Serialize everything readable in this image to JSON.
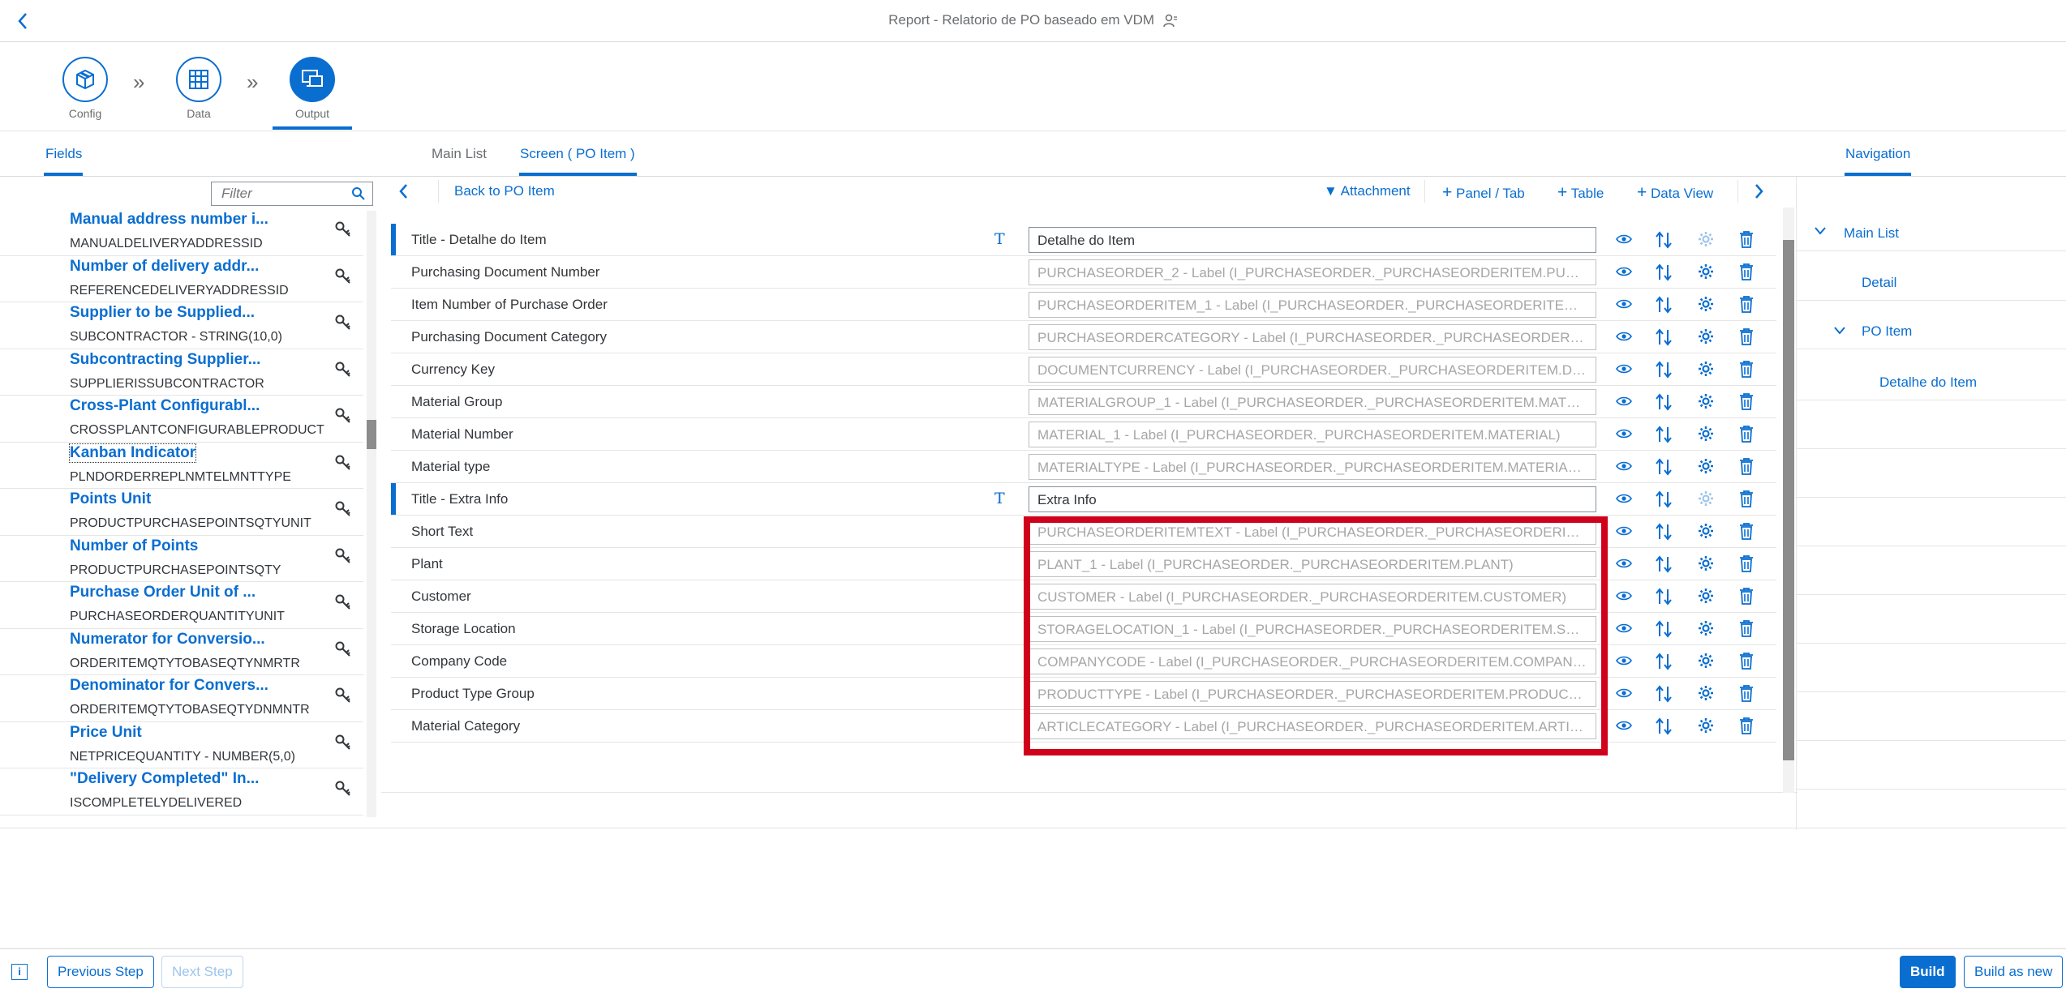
{
  "shell": {
    "title": "Report - Relatorio de PO baseado em VDM"
  },
  "wizard": {
    "steps": [
      {
        "label": "Config",
        "icon": "cube-icon"
      },
      {
        "label": "Data",
        "icon": "table-icon"
      },
      {
        "label": "Output",
        "icon": "output-icon",
        "active": true
      }
    ]
  },
  "tabs": {
    "fields": "Fields",
    "main_list": "Main List",
    "screen": "Screen ( PO Item )",
    "navigation": "Navigation"
  },
  "filter": {
    "placeholder": "Filter"
  },
  "fields": [
    {
      "name": "Manual address number i...",
      "id": "MANUALDELIVERYADDRESSID"
    },
    {
      "name": "Number of delivery addr...",
      "id": "REFERENCEDELIVERYADDRESSID"
    },
    {
      "name": "Supplier to be Supplied...",
      "id": "SUBCONTRACTOR - STRING(10,0)"
    },
    {
      "name": "Subcontracting Supplier...",
      "id": "SUPPLIERISSUBCONTRACTOR"
    },
    {
      "name": "Cross-Plant Configurabl...",
      "id": "CROSSPLANTCONFIGURABLEPRODUCT"
    },
    {
      "name": "Kanban Indicator",
      "id": "PLNDORDERREPLNMTELMNTTYPE"
    },
    {
      "name": "Points Unit",
      "id": "PRODUCTPURCHASEPOINTSQTYUNIT"
    },
    {
      "name": "Number of Points",
      "id": "PRODUCTPURCHASEPOINTSQTY"
    },
    {
      "name": "Purchase Order Unit of ...",
      "id": "PURCHASEORDERQUANTITYUNIT"
    },
    {
      "name": "Numerator for Conversio...",
      "id": "ORDERITEMQTYTOBASEQTYNMRTR"
    },
    {
      "name": "Denominator for Convers...",
      "id": "ORDERITEMQTYTOBASEQTYDNMNTR"
    },
    {
      "name": "Price Unit",
      "id": "NETPRICEQUANTITY - NUMBER(5,0)"
    },
    {
      "name": "\"Delivery Completed\" In...",
      "id": "ISCOMPLETELYDELIVERED"
    }
  ],
  "toolbar": {
    "back": "Back to PO Item",
    "attachment": "Attachment",
    "panel_tab": "Panel / Tab",
    "table": "Table",
    "data_view": "Data View"
  },
  "rows": [
    {
      "label": "Title - Detalhe do Item",
      "value": "Detalhe do Item",
      "title": true
    },
    {
      "label": "Purchasing Document Number",
      "value": "PURCHASEORDER_2 - Label (I_PURCHASEORDER._PURCHASEORDERITEM.PURC..."
    },
    {
      "label": "Item Number of Purchase Order",
      "value": "PURCHASEORDERITEM_1 - Label (I_PURCHASEORDER._PURCHASEORDERITEM.P..."
    },
    {
      "label": "Purchasing Document Category",
      "value": "PURCHASEORDERCATEGORY - Label (I_PURCHASEORDER._PURCHASEORDERITE..."
    },
    {
      "label": "Currency Key",
      "value": "DOCUMENTCURRENCY - Label (I_PURCHASEORDER._PURCHASEORDERITEM.DO..."
    },
    {
      "label": "Material Group",
      "value": "MATERIALGROUP_1 - Label (I_PURCHASEORDER._PURCHASEORDERITEM.MATER..."
    },
    {
      "label": "Material Number",
      "value": "MATERIAL_1 - Label (I_PURCHASEORDER._PURCHASEORDERITEM.MATERIAL)"
    },
    {
      "label": "Material type",
      "value": "MATERIALTYPE - Label (I_PURCHASEORDER._PURCHASEORDERITEM.MATERIALT..."
    },
    {
      "label": "Title - Extra Info",
      "value": "Extra Info",
      "title": true
    },
    {
      "label": "Short Text",
      "value": "PURCHASEORDERITEMTEXT - Label (I_PURCHASEORDER._PURCHASEORDERITE..."
    },
    {
      "label": "Plant",
      "value": "PLANT_1 - Label (I_PURCHASEORDER._PURCHASEORDERITEM.PLANT)"
    },
    {
      "label": "Customer",
      "value": "CUSTOMER - Label (I_PURCHASEORDER._PURCHASEORDERITEM.CUSTOMER)"
    },
    {
      "label": "Storage Location",
      "value": "STORAGELOCATION_1 - Label (I_PURCHASEORDER._PURCHASEORDERITEM.STO..."
    },
    {
      "label": "Company Code",
      "value": "COMPANYCODE - Label (I_PURCHASEORDER._PURCHASEORDERITEM.COMPANY..."
    },
    {
      "label": "Product Type Group",
      "value": "PRODUCTTYPE - Label (I_PURCHASEORDER._PURCHASEORDERITEM.PRODUCTT..."
    },
    {
      "label": "Material Category",
      "value": "ARTICLECATEGORY - Label (I_PURCHASEORDER._PURCHASEORDERITEM.ARTICL..."
    }
  ],
  "navigation": {
    "main_list": "Main List",
    "detail": "Detail",
    "po_item": "PO Item",
    "detalhe_do_item": "Detalhe do Item"
  },
  "footer": {
    "info": "i",
    "previous": "Previous Step",
    "next": "Next Step",
    "build": "Build",
    "build_as_new": "Build as new"
  },
  "colors": {
    "accent": "#0a6ed1",
    "highlight": "#d0021b"
  }
}
